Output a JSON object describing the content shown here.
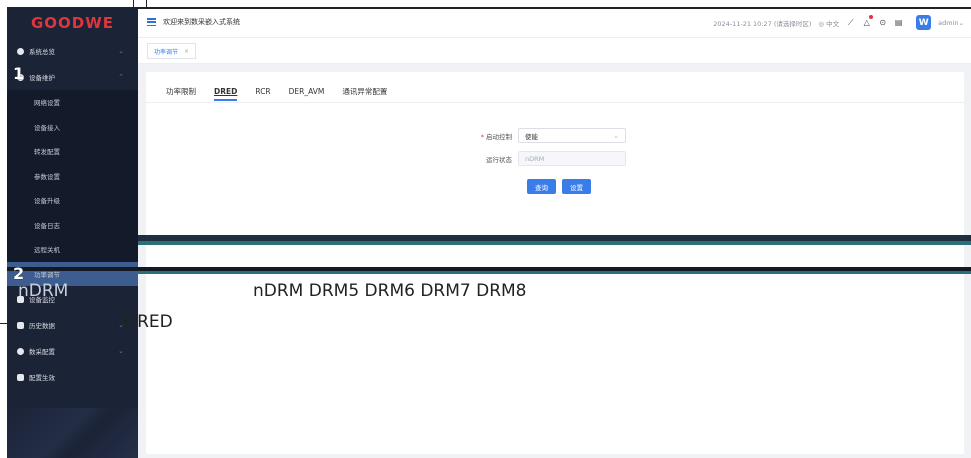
{
  "brand": {
    "logo_text": "GOODWE"
  },
  "sidebar": {
    "items": [
      {
        "label": "系统总览",
        "icon": "dashboard-icon"
      },
      {
        "label": "设备维护",
        "icon": "maintenance-icon"
      },
      {
        "label": "设备监控",
        "icon": "monitor-icon"
      },
      {
        "label": "历史数据",
        "icon": "history-icon"
      },
      {
        "label": "数采配置",
        "icon": "config-icon"
      },
      {
        "label": "配置生效",
        "icon": "apply-config-icon"
      }
    ],
    "submenu": [
      {
        "label": "网络设置"
      },
      {
        "label": "设备接入"
      },
      {
        "label": "转发配置"
      },
      {
        "label": "参数设置"
      },
      {
        "label": "设备升级"
      },
      {
        "label": "设备日志"
      },
      {
        "label": "远程关机"
      },
      {
        "label": "功率调节"
      }
    ]
  },
  "header": {
    "welcome": "欢迎来到数采嵌入式系统",
    "datetime": "2024-11-21 10:27 (请选择时区)",
    "language": "中文",
    "user": "admin",
    "avatar_letter": "W"
  },
  "tagsbar": {
    "tag_label": "功率调节",
    "close": "×"
  },
  "tabs": [
    "功率限制",
    "DRED",
    "RCR",
    "DER_AVM",
    "通讯异常配置"
  ],
  "form": {
    "start_control_label": "启动控制",
    "start_control_value": "使能",
    "run_status_label": "运行状态",
    "run_status_placeholder": "nDRM",
    "query_button": "查询",
    "set_button": "设置"
  },
  "annotations": {
    "num1": "1",
    "num2": "2",
    "callout_left": "nDRM",
    "callout_modes": "nDRM DRM5 DRM6 DRM7 DRM8",
    "callout_dred": "DRED"
  },
  "colors": {
    "sidebar_bg": "#1b2337",
    "accent": "#3b7de8",
    "brand": "#e0353d"
  }
}
